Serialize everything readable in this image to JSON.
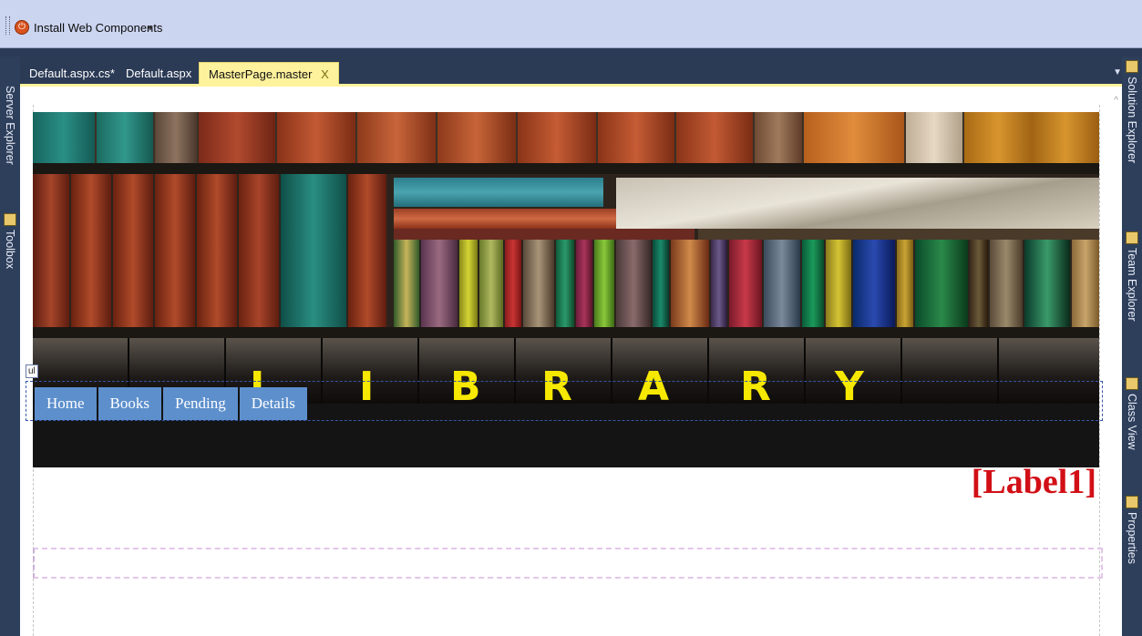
{
  "toolbar": {
    "install_label": "Install Web Components"
  },
  "tabs": [
    {
      "label": "Default.aspx.cs*"
    },
    {
      "label": "Default.aspx"
    },
    {
      "label": "MasterPage.master",
      "active": true,
      "close": "X"
    }
  ],
  "left_panels": [
    "Server Explorer",
    "Toolbox"
  ],
  "right_panels": [
    "Solution Explorer",
    "Team Explorer",
    "Class View",
    "Properties"
  ],
  "banner": {
    "letters": [
      "L",
      "I",
      "B",
      "R",
      "A",
      "R",
      "Y"
    ]
  },
  "menu": {
    "tag": "ul",
    "items": [
      "Home",
      "Books",
      "Pending",
      "Details"
    ]
  },
  "label1": "[Label1]",
  "colors": {
    "accent_tab": "#fff29d",
    "menu_item": "#5d8fcc",
    "label_red": "#d20f16",
    "ide_dark": "#2b3a55"
  }
}
